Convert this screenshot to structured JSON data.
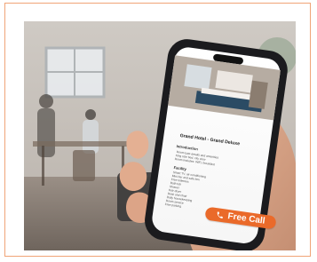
{
  "hotel": {
    "title": "Grand Hotel - Grand Deluxe",
    "intro_heading": "Introduction",
    "intro_lines": [
      "Room type details and amenities",
      "King size bed, city view",
      "Room includes: WiFi, breakfast"
    ],
    "facilities_heading": "Facility",
    "facility_lines": [
      "Smart TV, air conditioning",
      "Mini bar and safe box",
      "Free toiletries",
      "Bath tub",
      "Shower",
      "Hair dryer",
      "Desk and chair",
      "Daily housekeeping",
      "Room service",
      "Free parking"
    ]
  },
  "cta": {
    "label": "Free Call",
    "icon": "phone-icon",
    "color": "#ea6a2a"
  },
  "colors": {
    "frame_border": "#f0a477"
  }
}
